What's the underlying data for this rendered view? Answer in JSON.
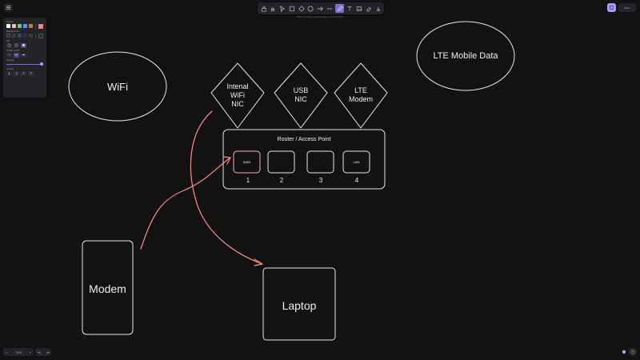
{
  "toolbar": {
    "hint": "Click and drag, release when you're finished"
  },
  "panel": {
    "stroke_label": "Stroke",
    "background_label": "Background",
    "fill_label": "Fill",
    "stroke_width_label": "Stroke width",
    "opacity_label": "Opacity",
    "layers_label": "Layers",
    "stroke_colors": [
      "#ffffff",
      "#ffb3b3",
      "#6bcb77",
      "#4d96ff",
      "#c08040",
      "#ff8080"
    ]
  },
  "zoom": {
    "value": "70%",
    "minus": "−",
    "plus": "+"
  },
  "share_label": "Share",
  "diagram": {
    "wifi": "WiFi",
    "lte_mobile": "LTE Mobile Data",
    "internal_nic": [
      "Intenal",
      "WiFi",
      "NIC"
    ],
    "usb_nic": [
      "USB",
      "NIC"
    ],
    "lte_modem": [
      "LTE",
      "Modem"
    ],
    "router_title": "Router / Access Point",
    "ports": [
      {
        "label": "WAN",
        "num": "1"
      },
      {
        "label": "",
        "num": "2"
      },
      {
        "label": "",
        "num": "3"
      },
      {
        "label": "LAN",
        "num": "4"
      }
    ],
    "modem": "Modem",
    "laptop": "Laptop"
  },
  "colors": {
    "accent": "#7a6fd6",
    "arrow": "#ff8c8c",
    "outline": "#e8e8e8",
    "canvas": "#121212"
  }
}
